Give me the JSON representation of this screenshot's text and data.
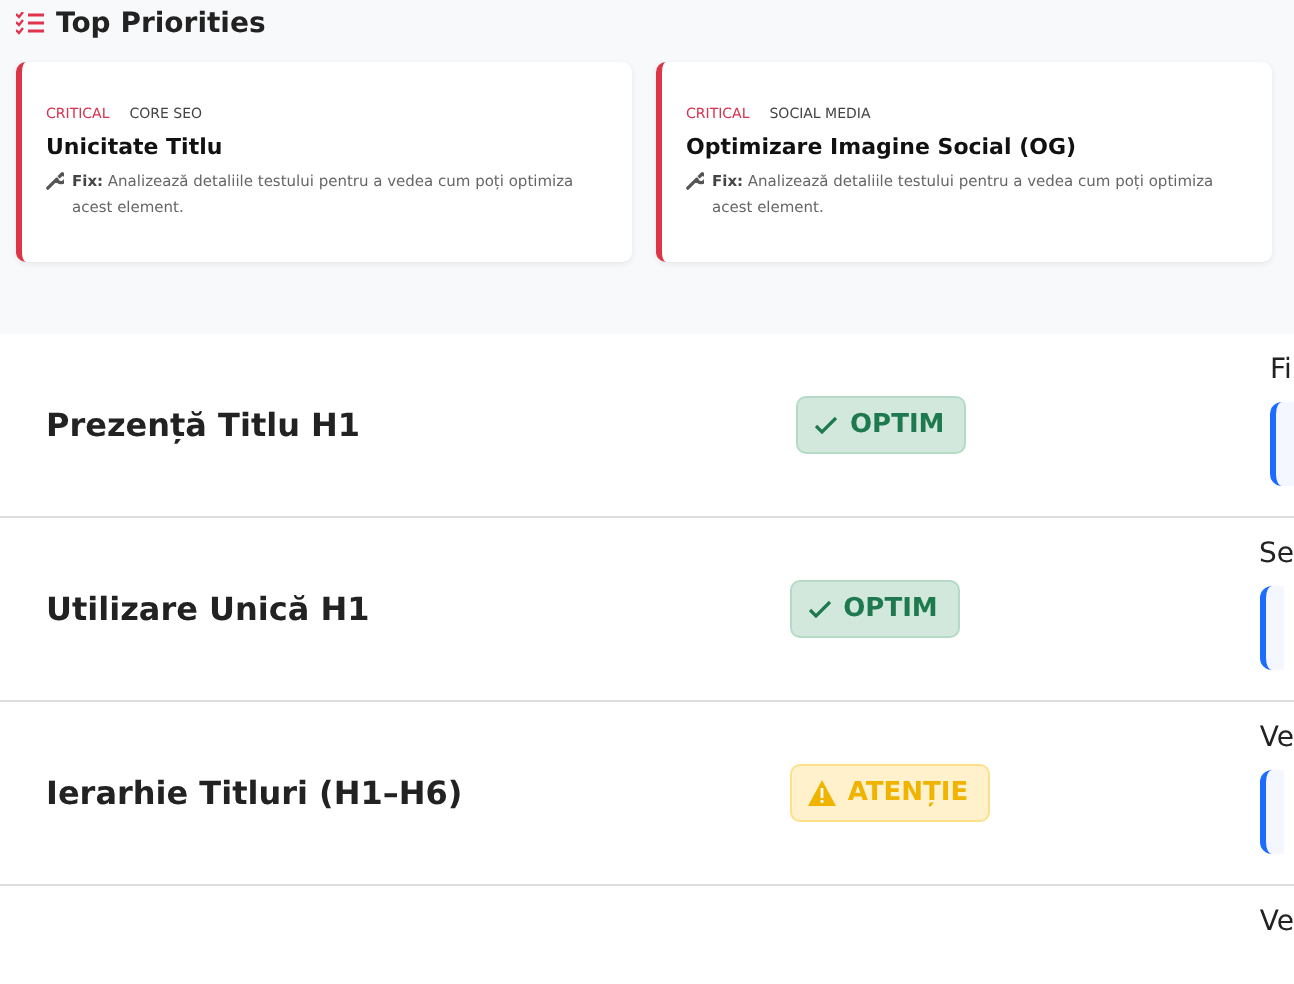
{
  "priorities": {
    "title": "Top Priorities",
    "cards": [
      {
        "severity": "CRITICAL",
        "category": "CORE SEO",
        "title": "Unicitate Titlu",
        "fix_label": "Fix:",
        "fix_text": "Analizează detaliile testului pentru a vedea cum poți optimiza acest element."
      },
      {
        "severity": "CRITICAL",
        "category": "SOCIAL MEDIA",
        "title": "Optimizare Imagine Social (OG)",
        "fix_label": "Fix:",
        "fix_text": "Analizează detaliile testului pentru a vedea cum poți optimiza acest element."
      }
    ]
  },
  "checks": [
    {
      "title": "Prezență Titlu H1",
      "kind": "ok",
      "badge": "OPTIM",
      "column_3": "Fi",
      "field": true
    },
    {
      "title": "Utilizare Unică H1",
      "kind": "ok",
      "badge": "OPTIM",
      "column_3": "Se",
      "field": true
    },
    {
      "title": "Ierarhie Titluri (H1–H6)",
      "kind": "warn",
      "badge": "ATENȚIE",
      "column_3": "Ve",
      "field": true
    },
    {
      "column_3": "Ve",
      "field": false
    }
  ]
}
